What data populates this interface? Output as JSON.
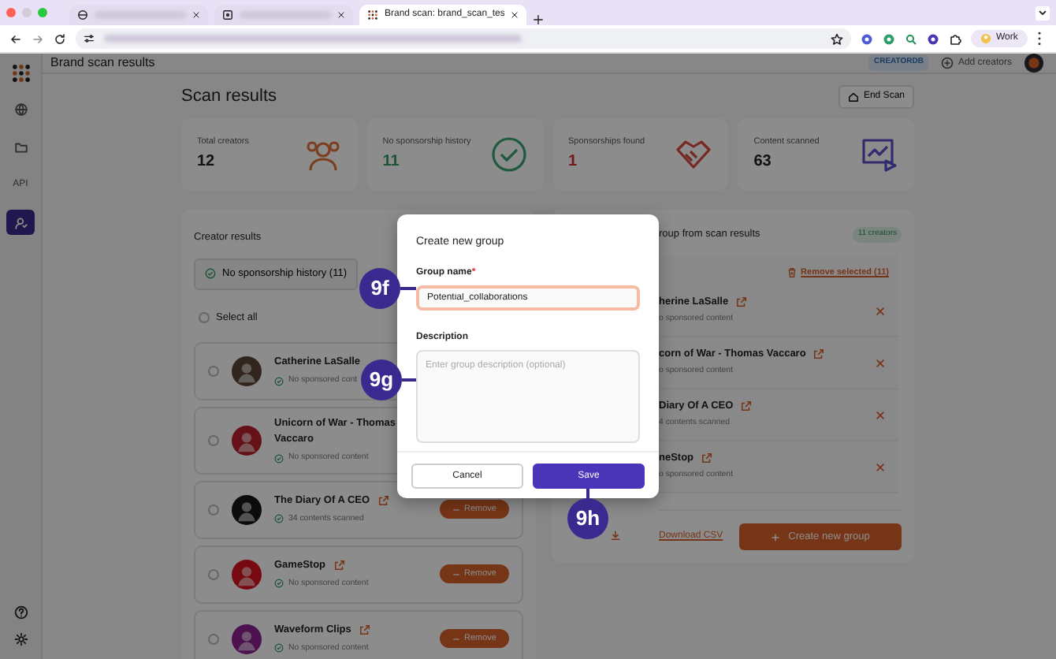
{
  "browser": {
    "tabs": [
      {
        "kind": "blurred",
        "selected": false
      },
      {
        "kind": "blurred",
        "selected": false
      },
      {
        "kind": "page",
        "title": "Brand scan: brand_scan_tes",
        "selected": true
      }
    ],
    "profile": "Work"
  },
  "app": {
    "title": "Brand scan results",
    "badge": "CREATORDB",
    "add_creators": "Add creators"
  },
  "sidebar": {
    "items": [
      {
        "kind": "icon",
        "selected": false
      },
      {
        "kind": "icon",
        "selected": false
      },
      {
        "kind": "text",
        "label": "API",
        "selected": false
      },
      {
        "kind": "icon",
        "selected": true
      }
    ]
  },
  "page": {
    "title": "Scan results",
    "end_scan": "End Scan"
  },
  "stats": [
    {
      "label": "Total creators",
      "value": "12"
    },
    {
      "label": "No sponsorship history",
      "value": "11"
    },
    {
      "label": "Sponsorships found",
      "value": "1"
    },
    {
      "label": "Content scanned",
      "value": "63"
    }
  ],
  "creator_results": {
    "title": "Creator results",
    "filter": "No sponsorship history (11)",
    "select_all": {
      "label": "Select all",
      "checked": false
    },
    "creators": [
      {
        "name": "Catherine LaSalle",
        "link": false,
        "status": "No sponsored cont",
        "checked": false
      },
      {
        "name": "Unicorn of War - Thomas Vaccaro",
        "link": false,
        "status": "No sponsored content",
        "checked": false
      },
      {
        "name": "The Diary Of A CEO",
        "link": true,
        "status": "34 contents scanned",
        "checked": false,
        "action": "Remove"
      },
      {
        "name": "GameStop",
        "link": true,
        "status": "No sponsored content",
        "checked": false,
        "action": "Remove"
      },
      {
        "name": "Waveform Clips",
        "link": true,
        "status": "No sponsored content",
        "checked": false,
        "action": "Remove"
      }
    ]
  },
  "group_panel": {
    "title": "roup from scan results",
    "count": "11 creators",
    "remove_selected": "Remove selected (11)",
    "members": [
      {
        "name": "herine LaSalle",
        "status": "o sponsored content"
      },
      {
        "name": "corn of War - Thomas Vaccaro",
        "status": "o sponsored content"
      },
      {
        "name": "Diary Of A CEO",
        "status": "4 contents scanned"
      },
      {
        "name": "neStop",
        "status": "o sponsored content"
      }
    ],
    "download": "Download CSV",
    "create": "Create new group"
  },
  "modal": {
    "title": "Create new group",
    "fields": [
      {
        "kind": "input",
        "label": "Group name",
        "required_mark": "*",
        "value": "Potential_collaborations",
        "focused": true
      },
      {
        "kind": "textarea",
        "label": "Description",
        "placeholder": "Enter group description (optional)",
        "focused": false
      }
    ],
    "buttons": [
      {
        "label": "Cancel",
        "kind": "secondary"
      },
      {
        "label": "Save",
        "kind": "primary"
      }
    ]
  },
  "callouts": [
    {
      "label": "9f"
    },
    {
      "label": "9g"
    },
    {
      "label": "9h"
    }
  ]
}
